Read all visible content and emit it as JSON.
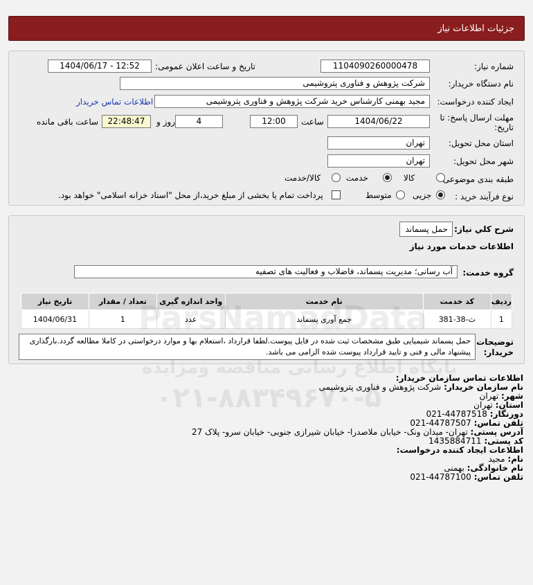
{
  "header": {
    "title": "جزئیات اطلاعات نیاز"
  },
  "form": {
    "need_number_label": "شماره نیاز:",
    "need_number": "1104090260000478",
    "announce_label": "تاریخ و ساعت اعلان عمومی:",
    "announce_value": "1404/06/17 - 12:52",
    "buyer_org_label": "نام دستگاه خریدار:",
    "buyer_org": "شرکت پژوهش و فناوری پتروشیمی",
    "creator_label": "ایجاد کننده درخواست:",
    "creator": "مجید بهمنی کارشناس خرید شرکت پژوهش و فناوری پتروشیمی",
    "buyer_contact_link": "اطلاعات تماس خریدار",
    "deadline_label_1": "مهلت ارسال پاسخ: تا",
    "deadline_label_2": "تاریخ:",
    "deadline_date": "1404/06/22",
    "time_label": "ساعت",
    "deadline_time": "12:00",
    "days_value": "4",
    "days_label": "روز و",
    "remaining_time": "22:48:47",
    "remaining_label": "ساعت باقی مانده",
    "province_label": "استان محل تحویل:",
    "province": "تهران",
    "city_label": "شهر محل تحویل:",
    "city": "تهران",
    "category_label": "طبقه بندی موضوعی:",
    "category_options": [
      "کالا",
      "خدمت",
      "کالا/خدمت"
    ],
    "category_selected": "خدمت",
    "process_label": "نوع فرآیند خرید :",
    "process_options": [
      "جزیی",
      "متوسط"
    ],
    "process_selected": "جزیی",
    "payment_note": "پرداخت تمام یا بخشی از مبلغ خرید،از محل \"اسناد خزانه اسلامی\" خواهد بود."
  },
  "summary": {
    "key_desc_label": "شرح کلي نياز:",
    "key_desc": "حمل پسماند",
    "services_title": "اطلاعات خدمات مورد نیاز",
    "service_group_label": "گروه خدمت:",
    "service_group": "آب رسانی؛ مدیریت پسماند، فاضلاب و فعالیت های تصفیه"
  },
  "table": {
    "headers": [
      "ردیف",
      "کد خدمت",
      "نام خدمت",
      "واحد اندازه گیری",
      "تعداد / مقدار",
      "تاریخ نیاز"
    ],
    "rows": [
      [
        "1",
        "ث-38-381",
        "جمع آوری پسماند",
        "عدد",
        "1",
        "1404/06/31"
      ]
    ]
  },
  "buyer_notes": {
    "label_1": "توضیحات",
    "label_2": "خریدار:",
    "text": "حمل پسماند شیمیایی طبق مشخصات ثبت شده در فایل پیوست.لطفا قرارداد ،استعلام بها و موارد درخواستی در کاملا مطالعه گردد.بارگذاری پیشنهاد مالی و فنی و تایید قرارداد پیوست شده الزامی می باشد."
  },
  "contact": {
    "org_section_title": "اطلاعات تماس سازمان خریدار:",
    "org_name_label": "نام سازمان خریدار:",
    "org_name": "شرکت پژوهش و فناوری پتروشیمی",
    "city_label": "شهر:",
    "city": "تهران",
    "province_label": "استان:",
    "province": "تهران",
    "fax_label": "دورنگار:",
    "fax": "021-44787518",
    "phone_label": "تلفن تماس:",
    "phone": "021-44787507",
    "address_label": "آدرس پستی:",
    "address": "تهران- میدان ونک- خیابان ملاصدرا- خیابان شیرازی جنوبی- خیابان سرو- پلاک 27",
    "postal_label": "کد پستی:",
    "postal": "1435884711",
    "creator_section_title": "اطلاعات ایجاد کننده درخواست:",
    "first_name_label": "نام:",
    "first_name": "مجید",
    "last_name_label": "نام خانوادگی:",
    "last_name": "بهمنی",
    "creator_phone_label": "تلفن تماس:",
    "creator_phone": "021-44787100"
  },
  "watermark": {
    "brand": "ParsNamadData",
    "tagline": "پایگاه اطلاع رسانی مناقصه ومزایده",
    "phone": "۰۲۱-۸۸۳۴۹۶۷۰-۵"
  }
}
